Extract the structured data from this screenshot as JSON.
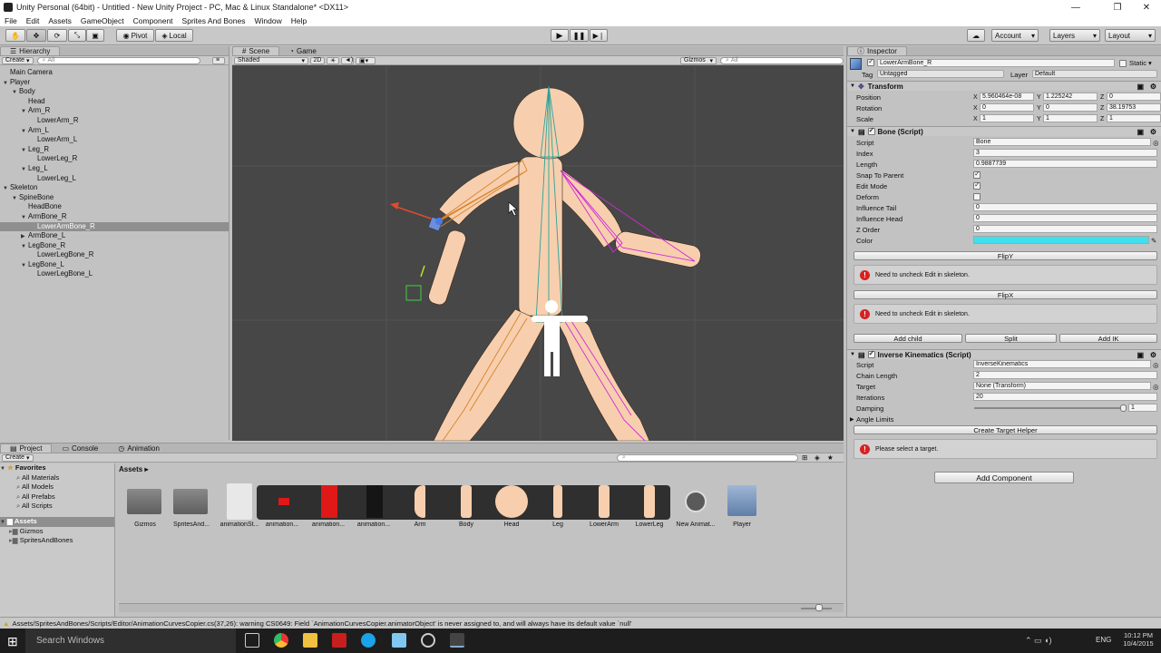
{
  "window": {
    "title": "Unity Personal (64bit) - Untitled - New Unity Project - PC, Mac & Linux Standalone* <DX11>"
  },
  "menu": [
    "File",
    "Edit",
    "Assets",
    "GameObject",
    "Component",
    "Sprites And Bones",
    "Window",
    "Help"
  ],
  "toolbar": {
    "pivot": "Pivot",
    "local": "Local",
    "account": "Account",
    "layers": "Layers",
    "layout": "Layout"
  },
  "hierarchy": {
    "tab": "Hierarchy",
    "create": "Create",
    "search_placeholder": "All",
    "items": [
      {
        "label": "Main Camera",
        "depth": 0,
        "arrow": ""
      },
      {
        "label": "Player",
        "depth": 0,
        "arrow": "▼"
      },
      {
        "label": "Body",
        "depth": 1,
        "arrow": "▼"
      },
      {
        "label": "Head",
        "depth": 2,
        "arrow": ""
      },
      {
        "label": "Arm_R",
        "depth": 2,
        "arrow": "▼"
      },
      {
        "label": "LowerArm_R",
        "depth": 3,
        "arrow": ""
      },
      {
        "label": "Arm_L",
        "depth": 2,
        "arrow": "▼"
      },
      {
        "label": "LowerArm_L",
        "depth": 3,
        "arrow": ""
      },
      {
        "label": "Leg_R",
        "depth": 2,
        "arrow": "▼"
      },
      {
        "label": "LowerLeg_R",
        "depth": 3,
        "arrow": ""
      },
      {
        "label": "Leg_L",
        "depth": 2,
        "arrow": "▼"
      },
      {
        "label": "LowerLeg_L",
        "depth": 3,
        "arrow": ""
      },
      {
        "label": "Skeleton",
        "depth": 0,
        "arrow": "▼"
      },
      {
        "label": "SpineBone",
        "depth": 1,
        "arrow": "▼"
      },
      {
        "label": "HeadBone",
        "depth": 2,
        "arrow": ""
      },
      {
        "label": "ArmBone_R",
        "depth": 2,
        "arrow": "▼"
      },
      {
        "label": "LowerArmBone_R",
        "depth": 3,
        "arrow": "",
        "selected": true
      },
      {
        "label": "ArmBone_L",
        "depth": 2,
        "arrow": "▶"
      },
      {
        "label": "LegBone_R",
        "depth": 2,
        "arrow": "▼"
      },
      {
        "label": "LowerLegBone_R",
        "depth": 3,
        "arrow": ""
      },
      {
        "label": "LegBone_L",
        "depth": 2,
        "arrow": "▼"
      },
      {
        "label": "LowerLegBone_L",
        "depth": 3,
        "arrow": ""
      }
    ]
  },
  "scene": {
    "tab_scene": "Scene",
    "tab_game": "Game",
    "shading": "Shaded",
    "mode2d": "2D",
    "gizmos": "Gizmos",
    "search_placeholder": "All"
  },
  "inspector": {
    "tab": "Inspector",
    "object_name": "LowerArmBone_R",
    "static": "Static",
    "tag_label": "Tag",
    "tag": "Untagged",
    "layer_label": "Layer",
    "layer": "Default",
    "transform": {
      "title": "Transform",
      "position_label": "Position",
      "rotation_label": "Rotation",
      "scale_label": "Scale",
      "position": [
        "5.960464e-08",
        "1.225242",
        "0"
      ],
      "rotation": [
        "0",
        "0",
        "38.19753"
      ],
      "scale": [
        "1",
        "1",
        "1"
      ]
    },
    "bone": {
      "title": "Bone (Script)",
      "fields": [
        {
          "label": "Script",
          "value": "Bone",
          "kind": "ref"
        },
        {
          "label": "Index",
          "value": "3",
          "kind": "text"
        },
        {
          "label": "Length",
          "value": "0.9887739",
          "kind": "text"
        },
        {
          "label": "Snap To Parent",
          "value": "on",
          "kind": "check"
        },
        {
          "label": "Edit Mode",
          "value": "on",
          "kind": "check"
        },
        {
          "label": "Deform",
          "value": "off",
          "kind": "check"
        },
        {
          "label": "Influence Tail",
          "value": "0",
          "kind": "text"
        },
        {
          "label": "Influence Head",
          "value": "0",
          "kind": "text"
        },
        {
          "label": "Z Order",
          "value": "0",
          "kind": "text"
        },
        {
          "label": "Color",
          "value": "#3fe0ee",
          "kind": "color"
        }
      ],
      "flipy": "FlipY",
      "flipx": "FlipX",
      "warning": "Need to uncheck Edit in skeleton.",
      "add_child": "Add child",
      "split": "Split",
      "add_ik": "Add IK"
    },
    "ik": {
      "title": "Inverse Kinematics (Script)",
      "fields": [
        {
          "label": "Script",
          "value": "InverseKinematics"
        },
        {
          "label": "Chain Length",
          "value": "2"
        },
        {
          "label": "Target",
          "value": "None (Transform)"
        },
        {
          "label": "Iterations",
          "value": "20"
        }
      ],
      "damping_label": "Damping",
      "damping": "1",
      "angle_limits": "Angle Limits",
      "create_target": "Create Target Helper",
      "warning": "Please select a target."
    },
    "add_component": "Add Component"
  },
  "project": {
    "tab_project": "Project",
    "tab_console": "Console",
    "tab_animation": "Animation",
    "create": "Create",
    "favorites_label": "Favorites",
    "favorites": [
      "All Materials",
      "All Models",
      "All Prefabs",
      "All Scripts"
    ],
    "assets_label": "Assets",
    "folders": [
      "Gizmos",
      "SpritesAndBones"
    ],
    "breadcrumb": "Assets ▸",
    "assets": [
      {
        "label": "Gizmos",
        "kind": "folder"
      },
      {
        "label": "SpritesAnd...",
        "kind": "folder"
      },
      {
        "label": "animationSt...",
        "kind": "strip"
      },
      {
        "label": "animation...",
        "kind": "red-small"
      },
      {
        "label": "animation...",
        "kind": "red-big"
      },
      {
        "label": "animation...",
        "kind": "dark"
      },
      {
        "label": "Arm",
        "kind": "arm"
      },
      {
        "label": "Body",
        "kind": "body"
      },
      {
        "label": "Head",
        "kind": "head"
      },
      {
        "label": "Leg",
        "kind": "leg"
      },
      {
        "label": "LowerArm",
        "kind": "lowerarm"
      },
      {
        "label": "LowerLeg",
        "kind": "lowerleg"
      },
      {
        "label": "New Animat...",
        "kind": "anim"
      },
      {
        "label": "Player",
        "kind": "prefab"
      }
    ]
  },
  "status": "Assets/SpritesAndBones/Scripts/Editor/AnimationCurvesCopier.cs(37,26): warning CS0649: Field `AnimationCurvesCopier.animatorObject' is never assigned to, and will always have its default value `null'",
  "taskbar": {
    "search": "Search Windows",
    "lang": "ENG",
    "time": "10:12 PM",
    "date": "10/4/2015"
  },
  "colors": {
    "skin": "#f7cfae",
    "bone_teal": "#2aa39a",
    "bone_orange": "#d8822a",
    "bone_magenta": "#d02ad8",
    "selection": "#8f8f8f"
  }
}
